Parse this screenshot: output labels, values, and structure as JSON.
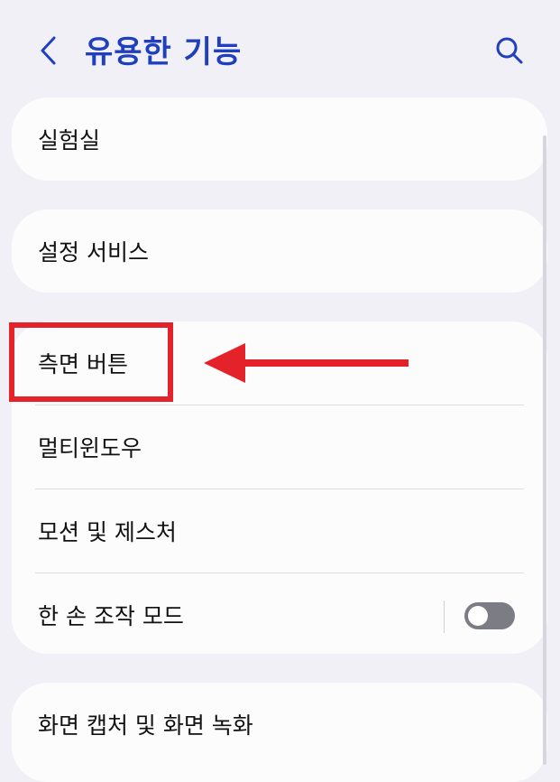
{
  "header": {
    "title": "유용한 기능"
  },
  "icons": {
    "back": "chevron-left-icon",
    "search": "search-icon"
  },
  "cards": {
    "lab": {
      "label": "실험실"
    },
    "setup": {
      "label": "설정 서비스"
    },
    "group": {
      "items": [
        {
          "label": "측면 버튼"
        },
        {
          "label": "멀티윈도우"
        },
        {
          "label": "모션 및 제스처"
        },
        {
          "label": "한 손 조작 모드",
          "toggle": false
        }
      ]
    },
    "capture": {
      "label": "화면 캡처 및 화면 녹화"
    }
  },
  "colors": {
    "accent": "#1f3fbf",
    "annotation": "#e3222a",
    "background": "#f0f0f6",
    "card": "#fcfcfd"
  }
}
